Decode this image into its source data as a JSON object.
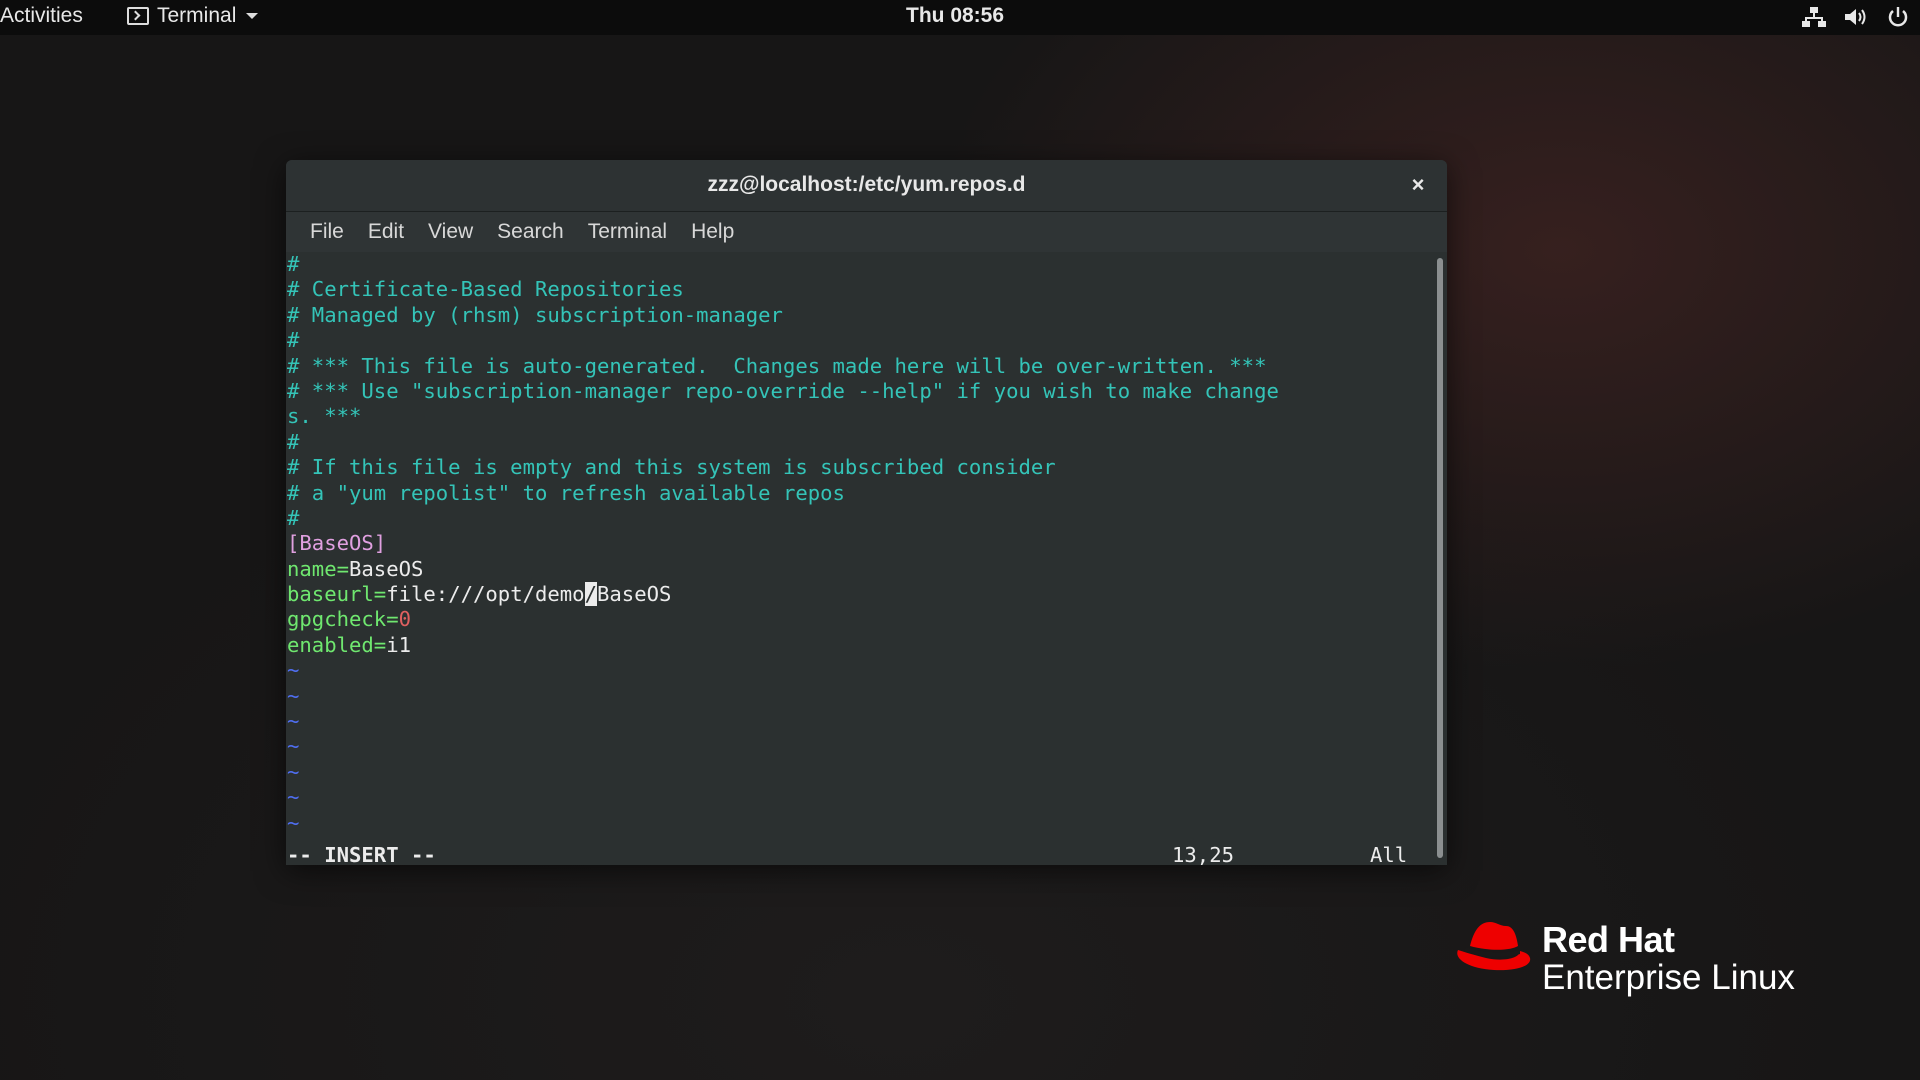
{
  "topbar": {
    "activities": "Activities",
    "app_menu": "Terminal",
    "clock": "Thu 08:56",
    "tray_icons": [
      "network-icon",
      "volume-icon",
      "power-icon"
    ]
  },
  "window": {
    "title": "zzz@localhost:/etc/yum.repos.d",
    "close_symbol": "×",
    "menu": [
      "File",
      "Edit",
      "View",
      "Search",
      "Terminal",
      "Help"
    ]
  },
  "editor": {
    "lines": [
      {
        "type": "comment",
        "text": "#"
      },
      {
        "type": "comment",
        "text": "# Certificate-Based Repositories"
      },
      {
        "type": "comment",
        "text": "# Managed by (rhsm) subscription-manager"
      },
      {
        "type": "comment",
        "text": "#"
      },
      {
        "type": "comment",
        "text": "# *** This file is auto-generated.  Changes made here will be over-written. ***"
      },
      {
        "type": "comment",
        "text": "# *** Use \"subscription-manager repo-override --help\" if you wish to make change"
      },
      {
        "type": "comment",
        "text": "s. ***"
      },
      {
        "type": "comment",
        "text": "#"
      },
      {
        "type": "comment",
        "text": "# If this file is empty and this system is subscribed consider"
      },
      {
        "type": "comment",
        "text": "# a \"yum repolist\" to refresh available repos"
      },
      {
        "type": "comment",
        "text": "#"
      },
      {
        "type": "section",
        "text": "[BaseOS]"
      },
      {
        "type": "kv",
        "key": "name=",
        "value": "BaseOS"
      },
      {
        "type": "kv_cursor",
        "key": "baseurl=",
        "before": "file:///opt/demo",
        "cursor": "/",
        "after": "BaseOS"
      },
      {
        "type": "kv_num",
        "key": "gpgcheck=",
        "value": "0"
      },
      {
        "type": "kv",
        "key": "enabled=",
        "value": "i1"
      },
      {
        "type": "tilde",
        "text": "~"
      },
      {
        "type": "tilde",
        "text": "~"
      },
      {
        "type": "tilde",
        "text": "~"
      },
      {
        "type": "tilde",
        "text": "~"
      },
      {
        "type": "tilde",
        "text": "~"
      },
      {
        "type": "tilde",
        "text": "~"
      },
      {
        "type": "tilde",
        "text": "~"
      }
    ],
    "status": {
      "mode": "-- INSERT --",
      "position": "13,25",
      "scroll": "All"
    }
  },
  "branding": {
    "line1": "Red Hat",
    "line2": "Enterprise Linux",
    "hat_color": "#ee0000"
  }
}
